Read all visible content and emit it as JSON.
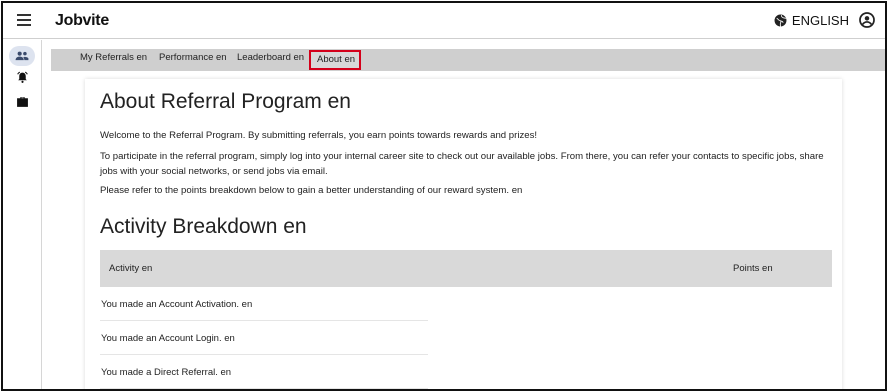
{
  "app": {
    "brand": "Jobvite",
    "language": "ENGLISH"
  },
  "icons": {
    "menu": "hamburger-menu-icon",
    "language": "globe-icon",
    "account": "account-circle-icon",
    "rail": [
      "people-icon",
      "alarm-bell-icon",
      "briefcase-icon"
    ]
  },
  "nav": {
    "tabs": [
      {
        "label": "My Referrals en"
      },
      {
        "label": "Performance en"
      },
      {
        "label": "Leaderboard en"
      },
      {
        "label": "About en"
      }
    ],
    "selected": "About en"
  },
  "main": {
    "title": "About Referral Program en",
    "paragraphs": [
      "Welcome to the Referral Program. By submitting referrals, you earn points towards rewards and prizes!",
      "To participate in the referral program, simply log into your internal career site to check out our available jobs. From there, you can refer your contacts to specific jobs, share jobs with your social networks, or send jobs via email.",
      "Please refer to the points breakdown below to gain a better understanding of our reward system. en"
    ],
    "breakdown_title": "Activity Breakdown en",
    "table": {
      "headers": [
        "Activity en",
        "Points en"
      ],
      "rows": [
        "You made an Account Activation. en",
        "You made an Account Login. en",
        "You made a Direct Referral. en"
      ]
    }
  },
  "colors": {
    "nav_background": "#cfcfcf",
    "selected_outline": "#d4001a",
    "active_rail_pill": "#dde3ef",
    "table_header": "#d9d9d9"
  }
}
